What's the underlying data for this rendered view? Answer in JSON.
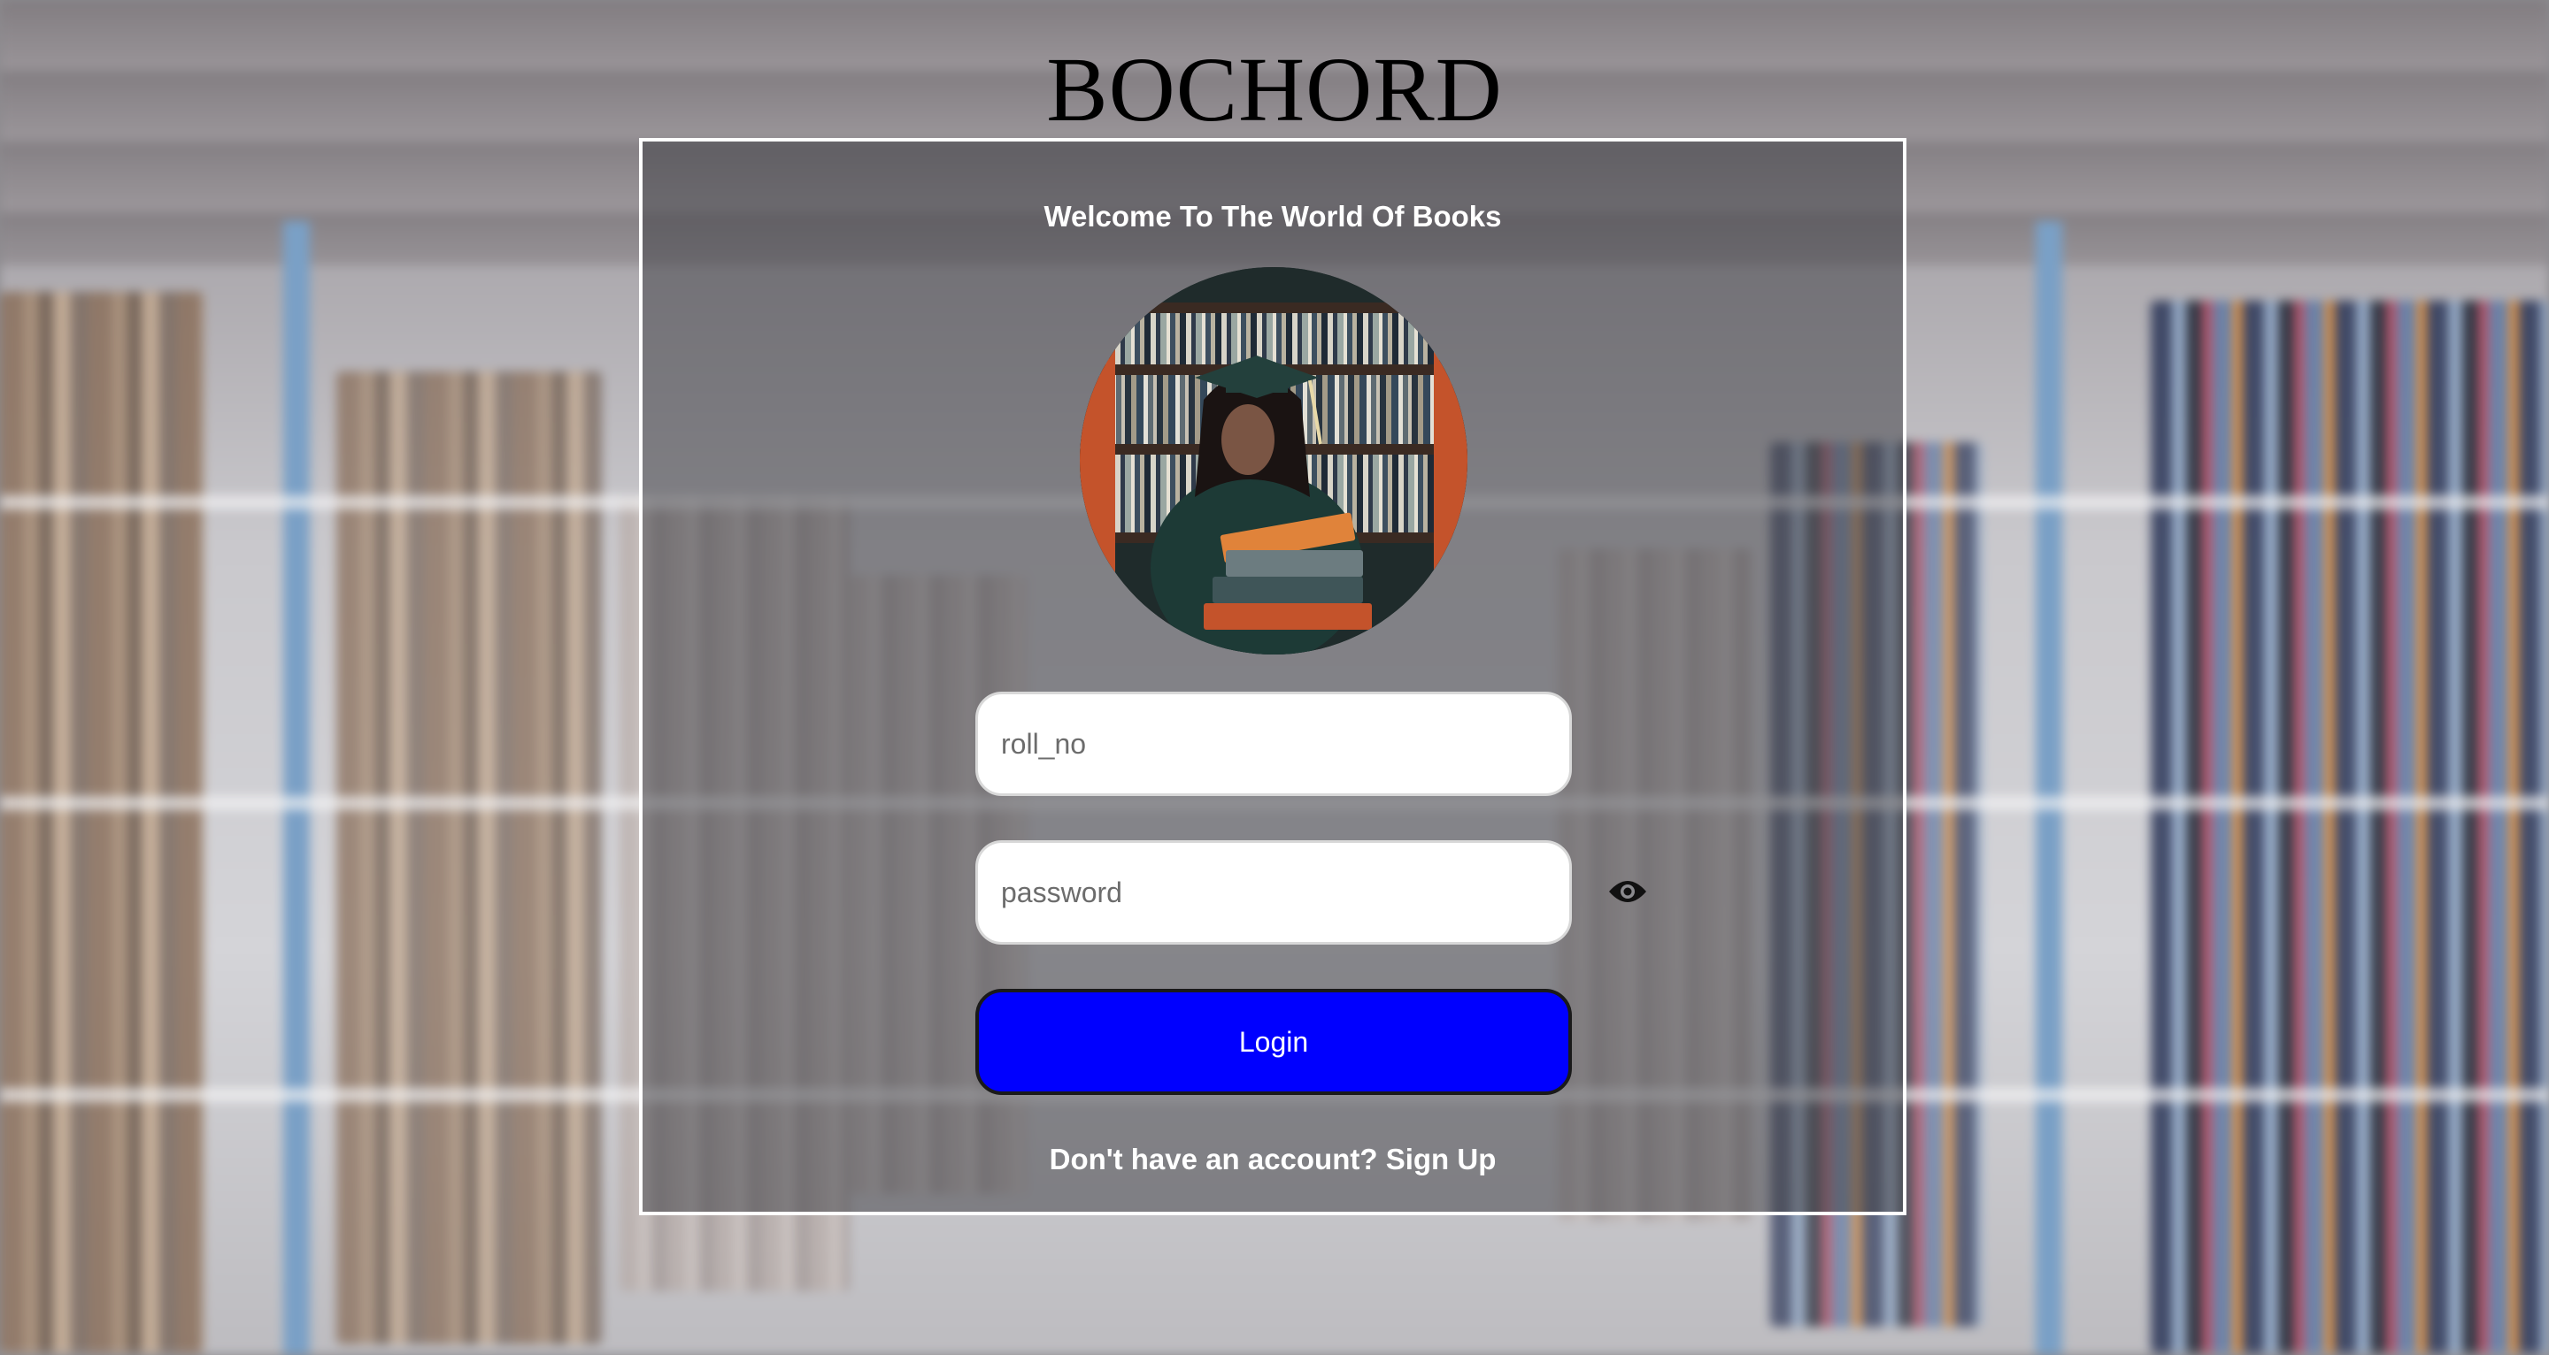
{
  "brand": {
    "title": "BOCHORD"
  },
  "login_card": {
    "welcome_text": "Welcome To The World Of Books",
    "roll_no": {
      "placeholder": "roll_no",
      "value": ""
    },
    "password": {
      "placeholder": "password",
      "value": ""
    },
    "login_button": "Login",
    "signup_prompt": "Don't have an account?",
    "signup_link": "Sign Up"
  },
  "icons": {
    "password_toggle": "eye-icon"
  },
  "colors": {
    "login_button": "#0000ff",
    "card_border": "#ffffff",
    "text_on_card": "#ffffff"
  }
}
